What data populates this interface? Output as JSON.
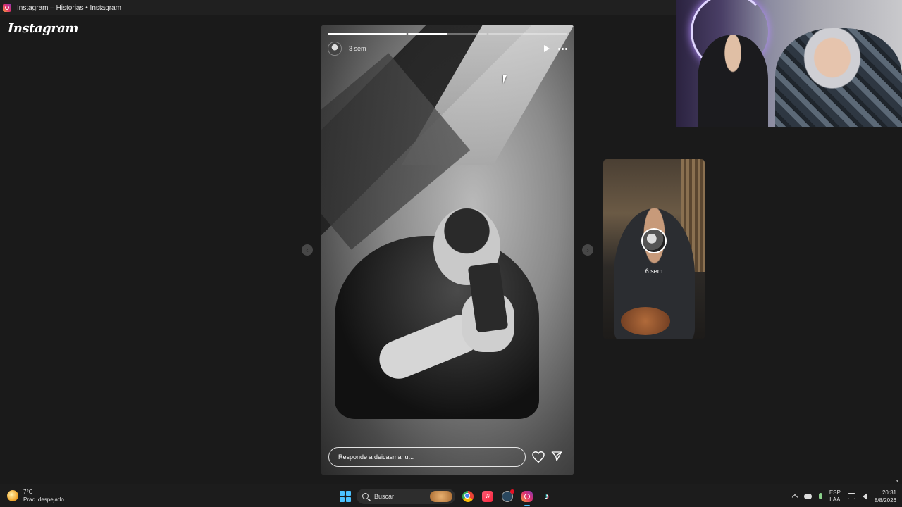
{
  "window": {
    "title": "Instagram – Historias • Instagram"
  },
  "header": {
    "logo": "Instagram"
  },
  "story": {
    "time": "3 sem",
    "progress": [
      1.0,
      0.5,
      0.0
    ],
    "reply_placeholder": "Responde a deicasmanu..."
  },
  "preview": {
    "time": "6 sem"
  },
  "taskbar": {
    "weather_temp": "7°C",
    "weather_desc": "Prac. despejado",
    "search_label": "Buscar",
    "lang_line1": "ESP",
    "lang_line2": "LAA",
    "time": "20:31",
    "date": "8/8/2026"
  },
  "icons": {
    "music": "♫",
    "tiktok": "♪"
  },
  "colors": {
    "accent": "#4cc2ff",
    "background": "#1a1a1a"
  }
}
